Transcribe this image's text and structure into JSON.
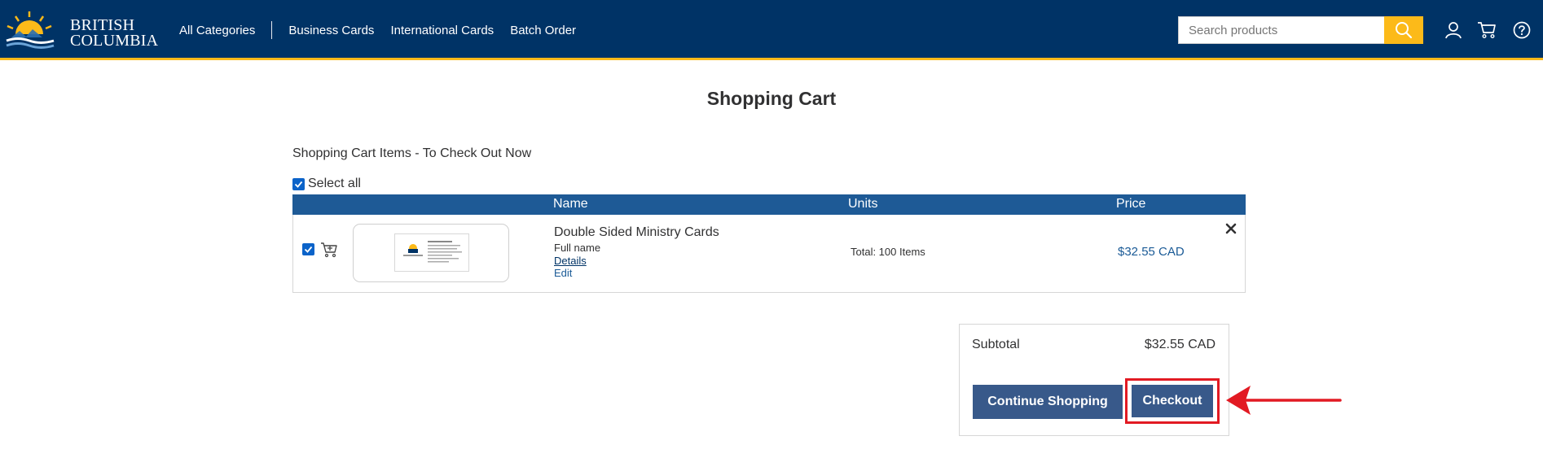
{
  "header": {
    "logo_text_line1": "BRITISH",
    "logo_text_line2": "COLUMBIA",
    "nav": [
      "All Categories",
      "Business Cards",
      "International Cards",
      "Batch Order"
    ],
    "search_placeholder": "Search products"
  },
  "page": {
    "title": "Shopping Cart",
    "cart_heading": "Shopping Cart Items - To Check Out Now",
    "select_all_label": "Select all"
  },
  "table": {
    "columns": [
      "Name",
      "Units",
      "Price"
    ],
    "items": [
      {
        "name": "Double Sided Ministry Cards",
        "subtitle": "Full name",
        "details_link": "Details",
        "edit_link": "Edit",
        "units": "Total: 100 Items",
        "price": "$32.55 CAD",
        "selected": true
      }
    ]
  },
  "summary": {
    "subtotal_label": "Subtotal",
    "subtotal_value": "$32.55 CAD",
    "continue_label": "Continue Shopping",
    "checkout_label": "Checkout"
  },
  "colors": {
    "header_bg": "#003366",
    "accent_gold": "#fcba19",
    "table_header": "#1e5a96",
    "button_bg": "#38598a",
    "highlight_red": "#e21a23"
  },
  "icons": [
    "search-icon",
    "user-icon",
    "cart-icon",
    "help-icon",
    "add-to-cart-icon",
    "close-icon",
    "arrow-icon"
  ]
}
